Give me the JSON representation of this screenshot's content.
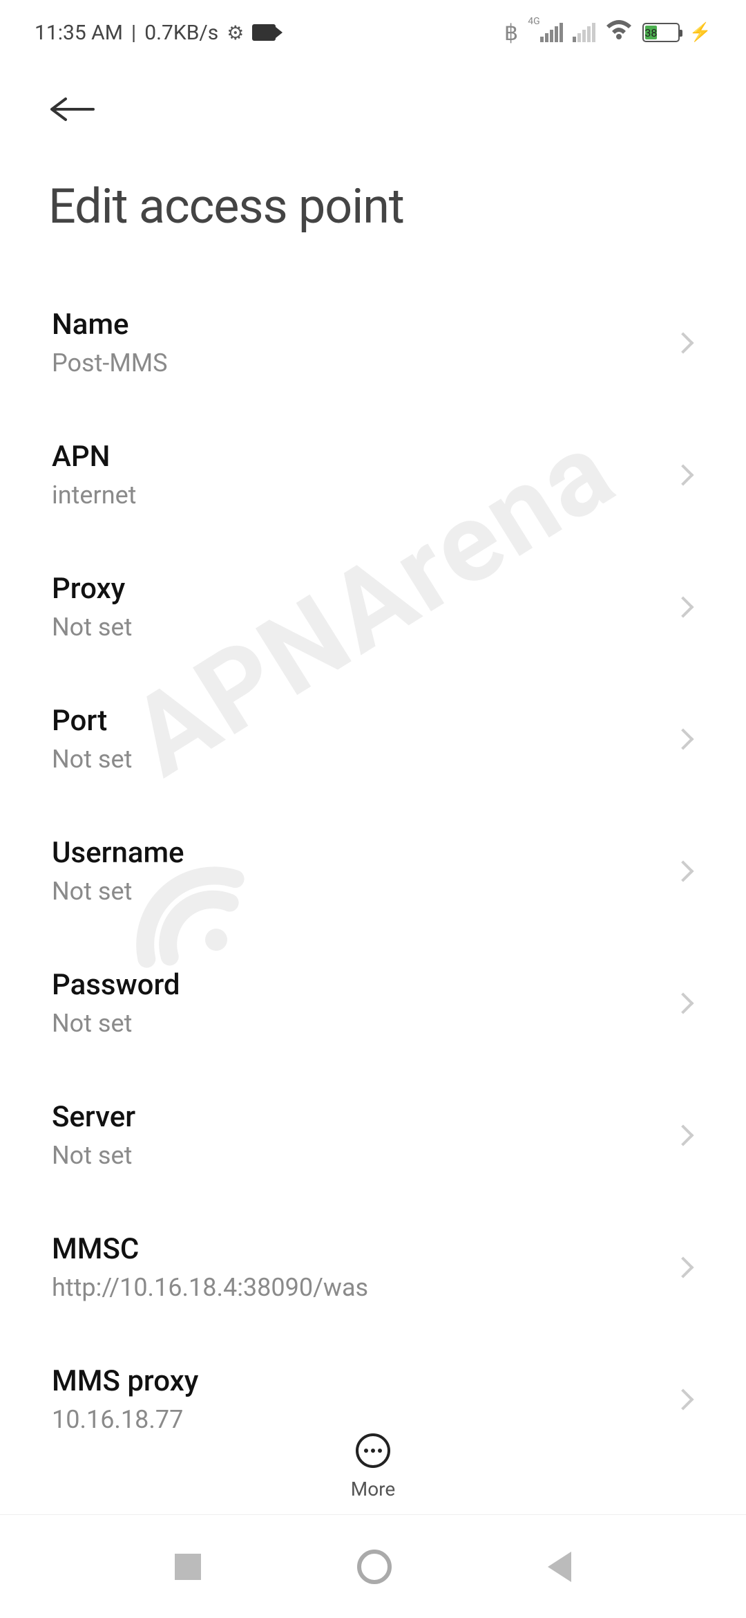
{
  "status_bar": {
    "time": "11:35 AM",
    "data_rate": "0.7KB/s",
    "network_label": "4G",
    "battery_percent": "38"
  },
  "header": {
    "title": "Edit access point"
  },
  "settings": [
    {
      "label": "Name",
      "value": "Post-MMS"
    },
    {
      "label": "APN",
      "value": "internet"
    },
    {
      "label": "Proxy",
      "value": "Not set"
    },
    {
      "label": "Port",
      "value": "Not set"
    },
    {
      "label": "Username",
      "value": "Not set"
    },
    {
      "label": "Password",
      "value": "Not set"
    },
    {
      "label": "Server",
      "value": "Not set"
    },
    {
      "label": "MMSC",
      "value": "http://10.16.18.4:38090/was"
    },
    {
      "label": "MMS proxy",
      "value": "10.16.18.77"
    }
  ],
  "bottom": {
    "more_label": "More"
  },
  "watermark_text": "APNArena"
}
